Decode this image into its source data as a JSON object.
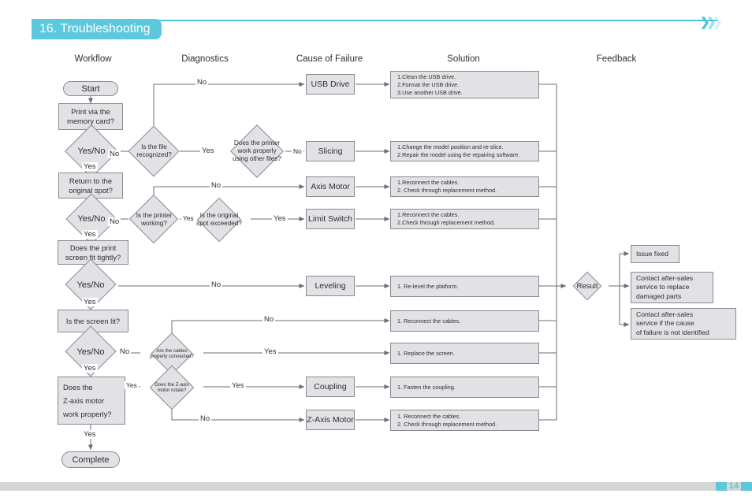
{
  "header": {
    "title": "16. Troubleshooting",
    "chevron_icon": "chevron-right",
    "accent_color": "#5cc8dd"
  },
  "footer": {
    "page_number": "14",
    "accent_color": "#5cc8dd",
    "bar_color": "#d6d6d6"
  },
  "columns": [
    {
      "label": "Workflow"
    },
    {
      "label": "Diagnostics"
    },
    {
      "label": "Cause of Failure"
    },
    {
      "label": "Solution"
    },
    {
      "label": "Feedback"
    }
  ],
  "workflow": {
    "start": "Start",
    "complete": "Complete",
    "steps": [
      {
        "label": "Print via the\nmemory card?"
      },
      {
        "label": "Return to the\noriginal spot?"
      },
      {
        "label": "Does the print\nscreen fit tightly?"
      },
      {
        "label": "Is the screen lit?"
      },
      {
        "label": "Does the\nZ-axis motor\nwork properly?"
      }
    ],
    "decisions": [
      {
        "label": "Yes/No"
      },
      {
        "label": "Yes/No"
      },
      {
        "label": "Yes/No"
      },
      {
        "label": "Yes/No"
      }
    ],
    "yes_labels": [
      "Yes",
      "Yes",
      "Yes",
      "Yes",
      "Yes"
    ],
    "no_labels": [
      "No",
      "No",
      "No"
    ]
  },
  "diagnostics": [
    {
      "label": "Is the file\nrecognized?"
    },
    {
      "label": "Does the printer\nwork properly\nusing other files?"
    },
    {
      "label": "Is the printer\nworking?"
    },
    {
      "label": "Is the original\nspot exceeded?"
    },
    {
      "label": "Are the cables\nproperly connected?"
    },
    {
      "label": "Does the Z-axis\nmotor rotate?"
    }
  ],
  "diagnostic_edges": {
    "file_no": "No",
    "file_yes": "Yes",
    "printer_other_files_no": "No",
    "printer_working_no": "No",
    "printer_working_yes": "Yes",
    "spot_exceeded_yes": "Yes",
    "leveling_no": "No",
    "cables_no": "No",
    "cables_yes": "Yes",
    "zmotor_yes": "Yes",
    "zmotor_no": "No"
  },
  "causes": [
    {
      "label": "USB Drive"
    },
    {
      "label": "Slicing"
    },
    {
      "label": "Axis Motor"
    },
    {
      "label": "Limit Switch"
    },
    {
      "label": "Leveling"
    },
    {
      "label": "Coupling"
    },
    {
      "label": "Z-Axis Motor"
    }
  ],
  "solutions": [
    {
      "text": "1.Clean the USB drive.\n2.Format the USB drive.\n3.Use another USB drive."
    },
    {
      "text": "1.Change the model position and re-slice.\n2.Repair the model using the repairing software."
    },
    {
      "text": "1.Reconnect the cables.\n2. Check through replacement method."
    },
    {
      "text": "1.Reconnect the cables.\n2.Check through replacement method."
    },
    {
      "text": "1. Re-level the platform."
    },
    {
      "text": "1. Reconnect the cables."
    },
    {
      "text": "1. Replace the screen."
    },
    {
      "text": "1. Fasten the coupling."
    },
    {
      "text": "1. Reconnect the cables.\n2. Check through replacement method."
    }
  ],
  "result": {
    "label": "Result"
  },
  "feedback": [
    {
      "text": "Issue fixed"
    },
    {
      "text": "Contact after-sales\nservice to replace\ndamaged parts"
    },
    {
      "text": "Contact after-sales\nservice if the cause\nof failure is not identified"
    }
  ]
}
